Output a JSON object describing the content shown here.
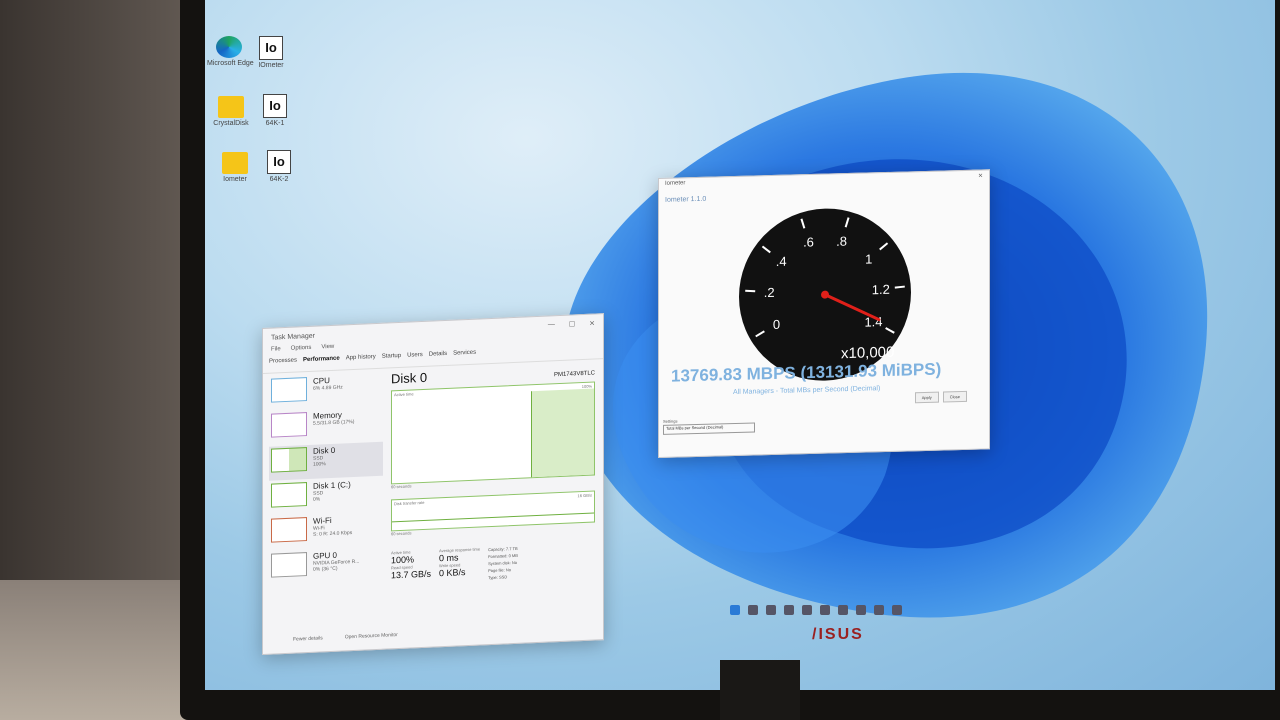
{
  "desktop": {
    "icons": [
      {
        "label": "Microsoft Edge",
        "icon": "edge-icon"
      },
      {
        "label": "IOmeter",
        "icon": "iometer-icon"
      },
      {
        "label": "CrystalDisk",
        "icon": "folder-icon"
      },
      {
        "label": "64K-1",
        "icon": "iometer-icon"
      },
      {
        "label": "Iometer",
        "icon": "folder-icon"
      },
      {
        "label": "64K-2",
        "icon": "iometer-icon"
      }
    ],
    "monitor_brand": "/ISUS"
  },
  "task_manager": {
    "title": "Task Manager",
    "menu": [
      "File",
      "Options",
      "View"
    ],
    "tabs": [
      "Processes",
      "Performance",
      "App history",
      "Startup",
      "Users",
      "Details",
      "Services"
    ],
    "active_tab": "Performance",
    "sidebar": [
      {
        "name": "CPU",
        "detail": "6%  4.89 GHz"
      },
      {
        "name": "Memory",
        "detail": "5.5/31.8 GB (17%)"
      },
      {
        "name": "Disk 0",
        "detail": "SSD",
        "detail2": "100%"
      },
      {
        "name": "Disk 1 (C:)",
        "detail": "SSD",
        "detail2": "0%"
      },
      {
        "name": "Wi-Fi",
        "detail": "Wi-Fi",
        "detail2": "S: 0  R: 24.0 Kbps"
      },
      {
        "name": "GPU 0",
        "detail": "NVIDIA GeForce R...",
        "detail2": "0% (36 °C)"
      }
    ],
    "main": {
      "title": "Disk 0",
      "model": "PM1743V8TLC",
      "graph1_label": "Active time",
      "graph1_max": "100%",
      "graph1_foot": "60 seconds",
      "graph2_label": "Disk transfer rate",
      "graph2_max": "16 GB/s",
      "graph2_foot": "60 seconds",
      "active_time_label": "Active time",
      "active_time_value": "100%",
      "response_label": "Average response time",
      "response_value": "0 ms",
      "read_label": "Read speed",
      "read_value": "13.7 GB/s",
      "write_label": "Write speed",
      "write_value": "0 KB/s",
      "capacity_label": "Capacity:",
      "capacity_value": "7.7 TB",
      "formatted_label": "Formatted:",
      "formatted_value": "0 MB",
      "system_disk_label": "System disk:",
      "system_disk_value": "No",
      "page_file_label": "Page file:",
      "page_file_value": "No",
      "type_label": "Type:",
      "type_value": "SSD"
    },
    "footer": {
      "fewer_details": "Fewer details",
      "open_monitor": "Open Resource Monitor"
    }
  },
  "iometer": {
    "window_title": "Iometer",
    "version": "Iometer 1.1.0",
    "gauge": {
      "ticks": [
        "0",
        ".2",
        ".4",
        ".6",
        ".8",
        "1",
        "1.2",
        "1.4"
      ],
      "multiplier": "x10,000",
      "needle_value": 1.377
    },
    "mbps_text": "13769.83 MBPS (13131.93 MiBPS)",
    "caption": "All Managers - Total MBs per Second (Decimal)",
    "settings_label": "Settings",
    "settings_value": "Total MBs per Second (Decimal)",
    "buttons": [
      "Apply",
      "Close"
    ]
  },
  "colors": {
    "accent": "#7fb2df",
    "disk_green": "#6fb040",
    "gauge_needle": "#e0201a"
  }
}
